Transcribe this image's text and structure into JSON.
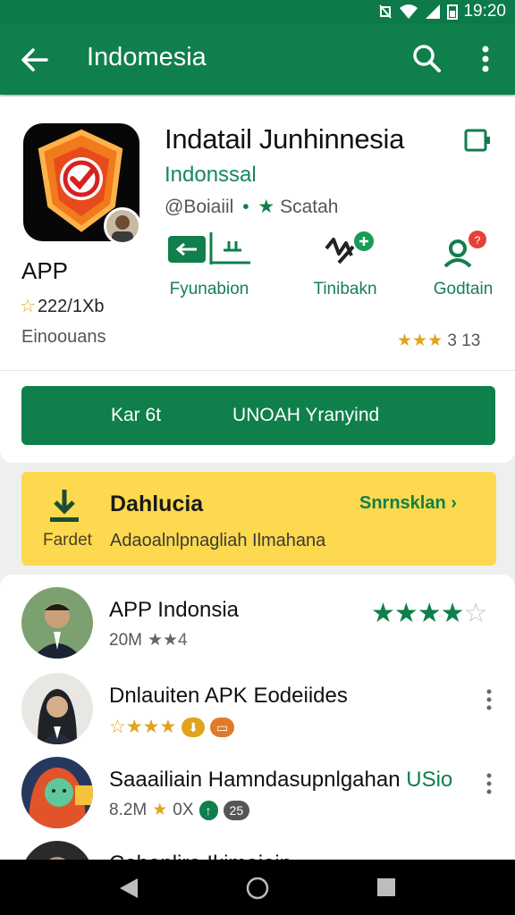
{
  "status_bar": {
    "time": "19:20"
  },
  "app_bar": {
    "title": "Indomesia"
  },
  "app": {
    "label": "APP",
    "rating": "222/1Xb",
    "sub": "Einoouans",
    "title": "Indatail Junhinnesia",
    "developer": "Indonssal",
    "handle": "@Boiaiil",
    "tag": "Scatah",
    "actions": [
      {
        "label": "Fyunabion"
      },
      {
        "label": "Tinibakn"
      },
      {
        "label": "Godtain"
      }
    ],
    "rating_right": "3 13"
  },
  "install": {
    "left_label": "Kar 6t",
    "right_label": "UNOAH  Yranyind"
  },
  "promo": {
    "icon_label": "Fardet",
    "heading": "Dahlucia",
    "link": "Snrnsklan",
    "description": "Adaoalnlpnagliah Ilmahana"
  },
  "list": [
    {
      "title": "APP Indonsia",
      "sub": "20M"
    },
    {
      "title": "Dnlauiten APK Eodeiides",
      "sub": ""
    },
    {
      "title": "Saaailiain Hamndasupnlgahan",
      "tag": "USio",
      "sub": "8.2M",
      "sub2": "0X",
      "badge": "25"
    },
    {
      "title": "Cohanlire Ikimaiain"
    }
  ],
  "colors": {
    "primary": "#0f7f4c",
    "promo": "#fdd94f",
    "star": "#e0a41d"
  }
}
